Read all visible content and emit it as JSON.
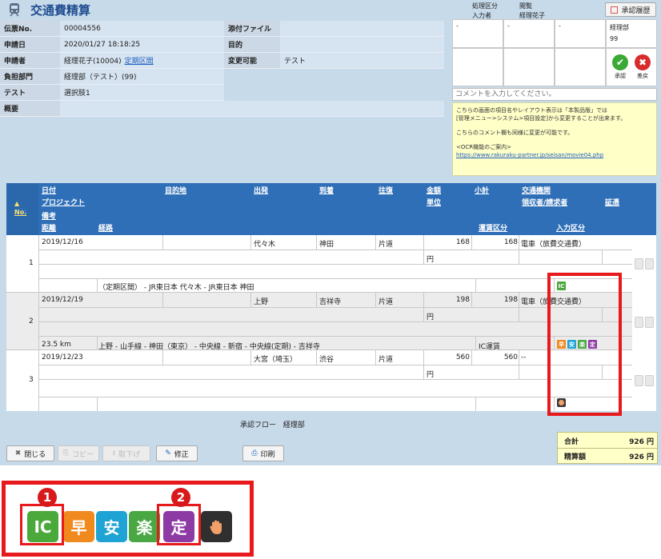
{
  "header": {
    "title": "交通費精算",
    "proc_label": "処理区分",
    "proc_value": "閲覧",
    "inputter_label": "入力者",
    "inputter_value": "経理花子",
    "history_button": "承認履歴"
  },
  "info": {
    "rows": [
      {
        "label": "伝票No.",
        "value": "00004556"
      },
      {
        "label": "申請日",
        "value": "2020/01/27 18:18:25"
      },
      {
        "label": "申請者",
        "value": "経理花子(10004)",
        "link": "定期区間"
      },
      {
        "label": "負担部門",
        "value": "経理部（テスト）(99)"
      },
      {
        "label": "テスト",
        "value": "選択肢1"
      },
      {
        "label": "概要",
        "value": ""
      }
    ],
    "right_rows": [
      {
        "label": "添付ファイル",
        "value": ""
      },
      {
        "label": "目的",
        "value": ""
      },
      {
        "label": "変更可能",
        "value": "テスト"
      }
    ]
  },
  "workflow": {
    "cells": [
      "-",
      "-",
      "-"
    ],
    "dept": "経理部",
    "dept_code": "99",
    "approve_label": "承認",
    "reject_label": "差戻"
  },
  "comment": {
    "placeholder": "コメントを入力してください。",
    "note_line1": "こちらの画面の項目名やレイアウト表示は「本製品版」では",
    "note_line2": "[管理メニュー>システム>項目設定]から変更することが出来ます。",
    "note_line3": "こちらのコメント欄も同様に変更が可能です。",
    "note_line4": "<OCR機能のご案内>",
    "note_link": "https://www.rakuraku-partner.jp/seisan/movie04.php"
  },
  "grid": {
    "no_label": "No.",
    "headers": {
      "date": "日付",
      "dest": "目的地",
      "from": "出発",
      "to": "到着",
      "trip": "往復",
      "amount": "金額",
      "subtotal": "小計",
      "agency": "交通機関",
      "project": "プロジェクト",
      "unit": "単位",
      "payee": "領収者/請求者",
      "voucher": "証憑",
      "note": "備考",
      "distance": "距離",
      "route": "経路",
      "fare_type": "運賃区分",
      "input_type": "入力区分"
    },
    "rows": [
      {
        "no": "1",
        "date": "2019/12/16",
        "from": "代々木",
        "to": "神田",
        "trip": "片道",
        "amount": "168",
        "subtotal": "168",
        "agency": "電車（旅費交通費）",
        "unit": "円",
        "distance": "",
        "route": "（定期区間） - JR東日本 代々木 - JR東日本 神田",
        "fare_type": ""
      },
      {
        "no": "2",
        "date": "2019/12/19",
        "from": "上野",
        "to": "吉祥寺",
        "trip": "片道",
        "amount": "198",
        "subtotal": "198",
        "agency": "電車（旅費交通費）",
        "unit": "円",
        "distance": "23.5 km",
        "route": "上野 - 山手線 - 神田（東京） - 中央線 - 新宿 - 中央線(定期) - 吉祥寺",
        "fare_type": "IC運賃"
      },
      {
        "no": "3",
        "date": "2019/12/23",
        "from": "大宮（埼玉）",
        "to": "渋谷",
        "trip": "片道",
        "amount": "560",
        "subtotal": "560",
        "agency": "--",
        "unit": "円",
        "distance": "",
        "route": "",
        "fare_type": ""
      }
    ]
  },
  "flow": {
    "label": "承認フロー",
    "value": "経理部"
  },
  "buttons": {
    "close": "閉じる",
    "copy": "コピー",
    "down": "取下げ",
    "edit": "修正",
    "print": "印刷"
  },
  "totals": {
    "total_label": "合計",
    "total_value": "926 円",
    "settle_label": "精算額",
    "settle_value": "926 円"
  },
  "legend": {
    "icons": [
      {
        "char": "IC",
        "name": "ic-icon",
        "color": "#4aa93a"
      },
      {
        "char": "早",
        "name": "fast-icon",
        "color": "#f08a1f"
      },
      {
        "char": "安",
        "name": "cheap-icon",
        "color": "#1fa3d4"
      },
      {
        "char": "楽",
        "name": "easy-icon",
        "color": "#49a844"
      },
      {
        "char": "定",
        "name": "commuter-pass-icon",
        "color": "#8e3aa4"
      }
    ],
    "markers": [
      "1",
      "2"
    ]
  },
  "colors": {
    "accent": "#2f6fb7",
    "highlight": "#e8191c",
    "note_bg": "#ffffc8"
  }
}
